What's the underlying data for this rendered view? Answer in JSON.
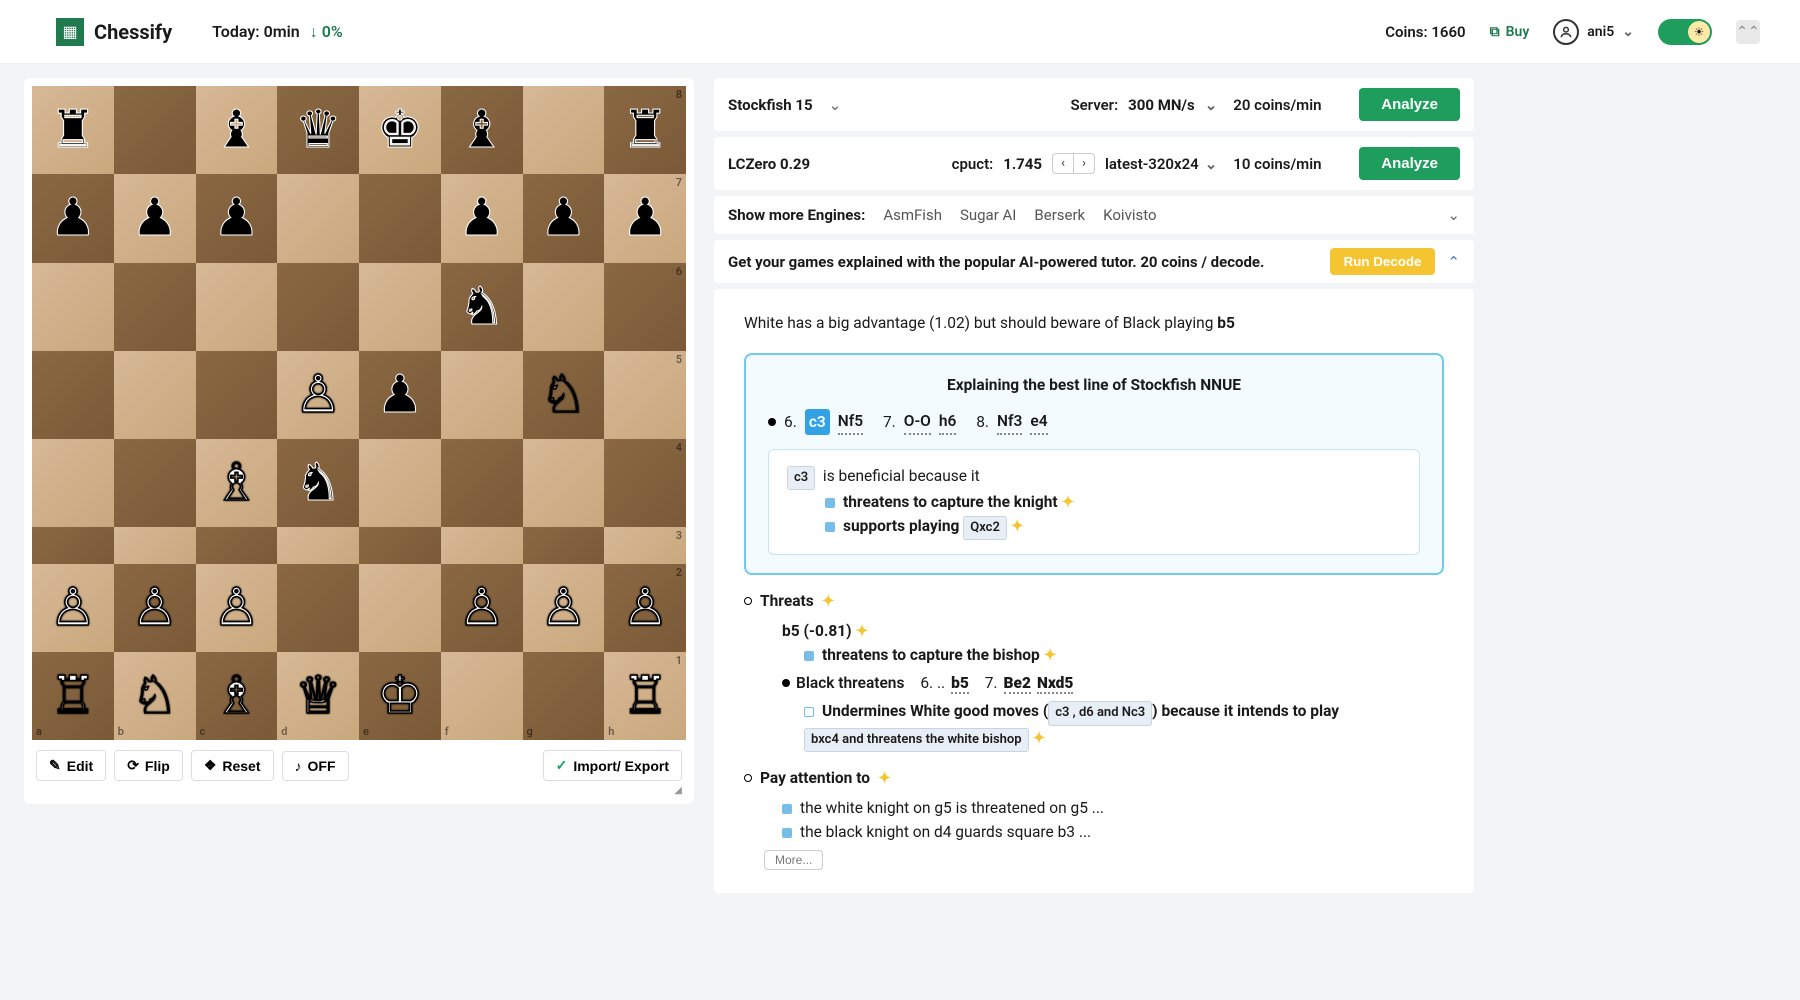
{
  "header": {
    "brand": "Chessify",
    "today_label": "Today:",
    "today_min": "0min",
    "today_pct": "↓ 0%",
    "coins_label": "Coins:",
    "coins_value": "1660",
    "buy_label": "Buy",
    "user": "ani5"
  },
  "board": {
    "fen_rows": [
      [
        "r",
        ".",
        "b",
        "q",
        "k",
        "b",
        ".",
        "r"
      ],
      [
        "p",
        "p",
        "p",
        ".",
        ".",
        "p",
        "p",
        "p"
      ],
      [
        ".",
        ".",
        ".",
        ".",
        ".",
        "n",
        ".",
        "."
      ],
      [
        ".",
        ".",
        ".",
        "P",
        "p",
        ".",
        "N",
        "."
      ],
      [
        ".",
        ".",
        "B",
        "n",
        ".",
        ".",
        ".",
        "."
      ],
      [
        ".",
        ".",
        ".",
        ".",
        ".",
        ".",
        ".",
        "."
      ],
      [
        "P",
        "P",
        "P",
        ".",
        ".",
        "P",
        "P",
        "P"
      ],
      [
        "R",
        "N",
        "B",
        "Q",
        "K",
        ".",
        ".",
        "R"
      ]
    ],
    "actions": {
      "edit": "Edit",
      "flip": "Flip",
      "reset": "Reset",
      "off": "OFF",
      "import_export": "Import/ Export"
    }
  },
  "engines": [
    {
      "name": "Stockfish 15",
      "server_label": "Server:",
      "server_value": "300 MN/s",
      "rate": "20 coins/min"
    },
    {
      "name": "LCZero 0.29",
      "cpuct_label": "cpuct:",
      "cpuct_value": "1.745",
      "net": "latest-320x24",
      "rate": "10 coins/min"
    }
  ],
  "analyze_label": "Analyze",
  "more_engines": {
    "label": "Show more Engines:",
    "items": [
      "AsmFish",
      "Sugar AI",
      "Berserk",
      "Koivisto"
    ]
  },
  "decode": {
    "text": "Get your games explained with the popular AI-powered tutor. 20 coins / decode.",
    "button": "Run Decode"
  },
  "analysis": {
    "summary_pre": "White has a big advantage (1.02) but should beware of Black playing ",
    "summary_bold": "b5",
    "expl_title": "Explaining the best line of Stockfish NNUE",
    "line": {
      "n6": "6.",
      "c3": "c3",
      "nf5": "Nf5",
      "n7": "7.",
      "oo": "O-O",
      "h6": "h6",
      "n8": "8.",
      "nf3": "Nf3",
      "e4": "e4"
    },
    "c3box": {
      "move": "c3",
      "lead": "is beneficial because it",
      "b1": "threatens to capture the knight",
      "b2_a": "supports playing ",
      "b2_b": "Qxc2"
    },
    "threats": {
      "title": "Threats",
      "b5": "b5 (-0.81)",
      "b5_line": "threatens to capture the bishop",
      "black_threatens": "Black threatens",
      "bt_n6": "6. ..",
      "bt_b5": "b5",
      "bt_n7": "7.",
      "bt_be2": "Be2",
      "bt_nxd5": "Nxd5",
      "undermines_a": "Undermines White good moves (",
      "undermines_b": "c3 , d6  and Nc3",
      "undermines_c": ") because it intends to play ",
      "undermines_d": "bxc4 and threatens the white bishop"
    },
    "attention": {
      "title": "Pay attention to",
      "a1": "the white knight on g5 is threatened on g5 ...",
      "a2": "the black knight on d4 guards square b3 ...",
      "more": "More..."
    }
  }
}
